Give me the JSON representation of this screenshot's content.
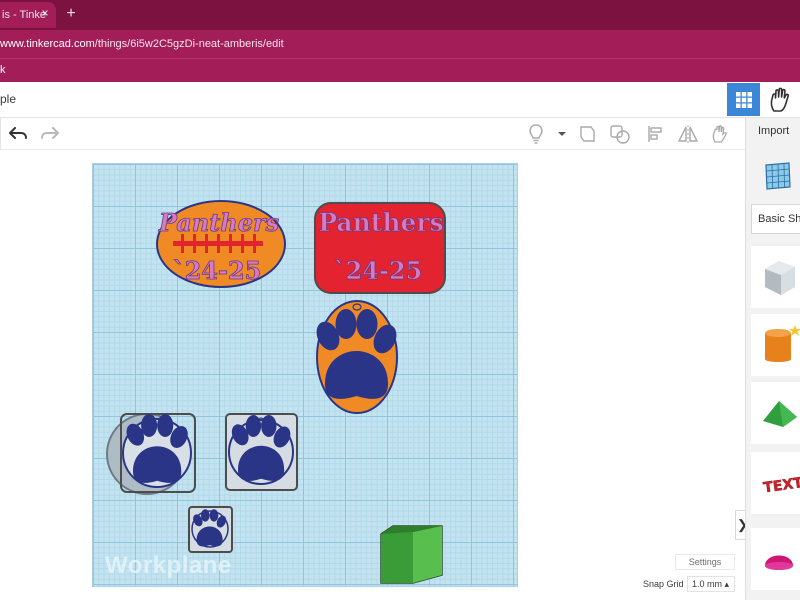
{
  "browser": {
    "tab_title": "is - Tinke",
    "tab_close": "×",
    "new_tab": "+",
    "url_host": "www.tinkercad.com",
    "url_path": "/things/6i5w2C5gzDi-neat-amberis/edit",
    "bookmark": "k"
  },
  "app": {
    "design_name": "ple"
  },
  "workplane": {
    "label": "Workplane",
    "settings_label": "Settings",
    "snap_grid_label": "Snap Grid",
    "snap_grid_value": "1.0 mm ▴"
  },
  "shapes": {
    "text_1_line1": "Panthers",
    "text_1_line2": "`24-25",
    "text_2_line1": "Panthers",
    "text_2_line2": "`24-25"
  },
  "right_panel": {
    "import_label": "Import",
    "basic_shapes_label": "Basic Shapes",
    "text_shape_label": "TEXT",
    "collapse_icon": "❯"
  },
  "colors": {
    "browser_dark": "#7c1240",
    "browser_mid": "#a31d58",
    "workplane": "#c3e3f0",
    "paw_navy": "#2a3588",
    "orange": "#f08a24",
    "red": "#e3232f",
    "pink_text": "#d67ac2",
    "accent_blue": "#3b86d6"
  }
}
